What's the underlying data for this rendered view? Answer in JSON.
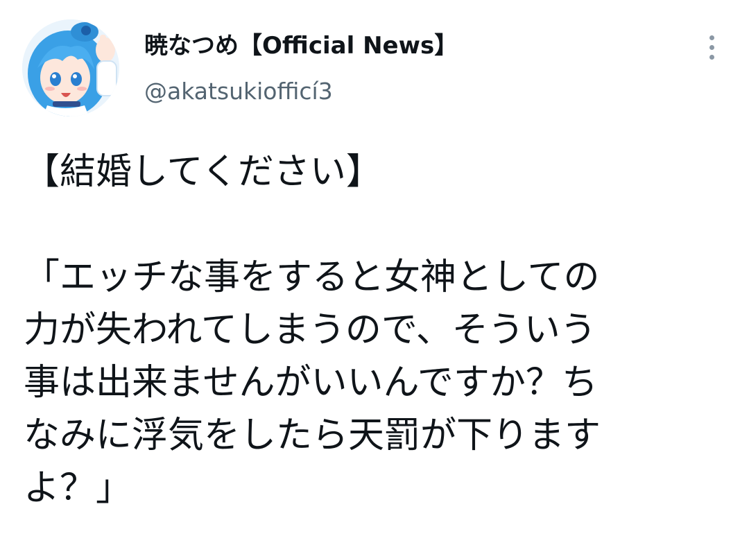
{
  "user": {
    "display_name": "暁なつめ【Official News】",
    "handle": "@akatsukiofficí3"
  },
  "icons": {
    "more": "more-vertical-icon",
    "avatar": "anime-avatar"
  },
  "tweet": {
    "lines": [
      "【結婚してください】",
      "「エッチな事をすると女神としての",
      "力が失われてしまうので、そういう",
      "事は出来ませんがいいんですか？ち",
      "なみに浮気をしたら天罰が下ります",
      "よ？」"
    ]
  },
  "colors": {
    "text": "#0f1419",
    "secondary": "#536471",
    "avatar_hair": "#3aa0e6"
  }
}
